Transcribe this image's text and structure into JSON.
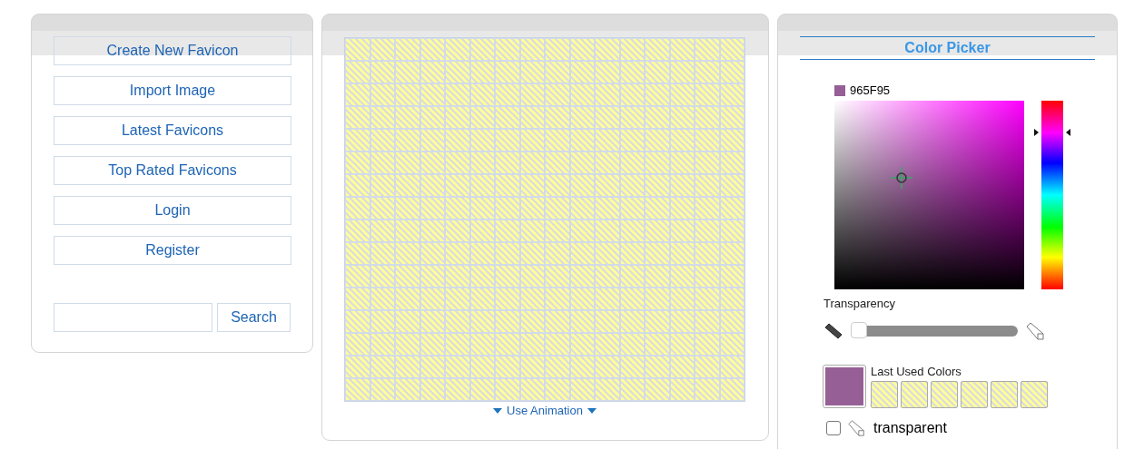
{
  "nav": [
    {
      "label": "Create New Favicon"
    },
    {
      "label": "Import Image"
    },
    {
      "label": "Latest Favicons"
    },
    {
      "label": "Top Rated Favicons"
    },
    {
      "label": "Login"
    },
    {
      "label": "Register"
    }
  ],
  "search": {
    "button": "Search"
  },
  "editor": {
    "animation_toggle": "Use Animation"
  },
  "color_picker": {
    "title": "Color Picker",
    "hex": "965F95",
    "color": "#965f95",
    "transparency_label": "Transparency",
    "transparency": {
      "level": 0
    },
    "last_used_label": "Last Used Colors",
    "last_used": [
      {
        "kind": "transparent"
      },
      {
        "kind": "transparent"
      },
      {
        "kind": "transparent"
      },
      {
        "kind": "transparent"
      },
      {
        "kind": "transparent"
      },
      {
        "kind": "transparent"
      }
    ],
    "options": [
      {
        "label": "transparent",
        "checked": false
      }
    ]
  }
}
